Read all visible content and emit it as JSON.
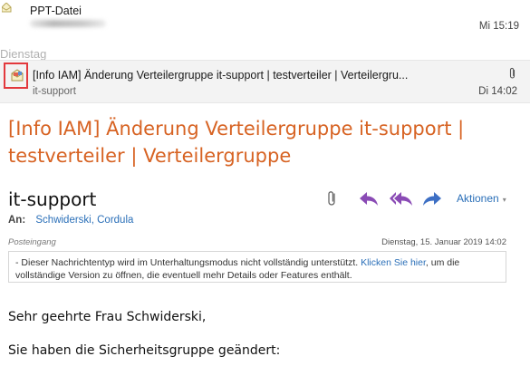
{
  "mail_list": {
    "items": [
      {
        "subject": "PPT-Datei",
        "sender": "",
        "time": "Mi 15:19",
        "icon": "envelope-icon"
      }
    ],
    "group_header": "Dienstag",
    "selected": {
      "subject": "[Info IAM] Änderung Verteilergruppe it-support | testverteiler | Verteilergru...",
      "sender": "it-support",
      "time": "Di 14:02",
      "icon": "mail-attachment-icon",
      "has_attachment": true
    }
  },
  "message": {
    "title": "[Info IAM] Änderung Verteilergruppe it-support | testverteiler | Verteilergruppe",
    "from": "it-support",
    "actions": {
      "attachment_icon": "paperclip-icon",
      "reply_icon": "reply-icon",
      "reply_all_icon": "reply-all-icon",
      "forward_icon": "forward-icon",
      "aktionen_label": "Aktionen",
      "aktionen_caret": "▾"
    },
    "to_label": "An:",
    "to_name": "Schwiderski, Cordula",
    "folder": "Posteingang",
    "date": "Dienstag, 15. Januar 2019 14:02",
    "infobar": {
      "prefix": "- Dieser Nachrichtentyp wird im Unterhaltungsmodus nicht vollständig unterstützt.",
      "link": "Klicken Sie hier",
      "suffix": ", um die vollständige Version zu öffnen, die eventuell mehr Details oder Features enthält."
    },
    "body": {
      "greeting": "Sehr geehrte Frau Schwiderski,",
      "line2": "Sie haben die Sicherheitsgruppe geändert:"
    }
  },
  "colors": {
    "title": "#d76323",
    "link": "#2a6fb8",
    "action_purple": "#8a4bb5",
    "forward_blue": "#3d6fc4",
    "highlight": "#e3393d"
  }
}
